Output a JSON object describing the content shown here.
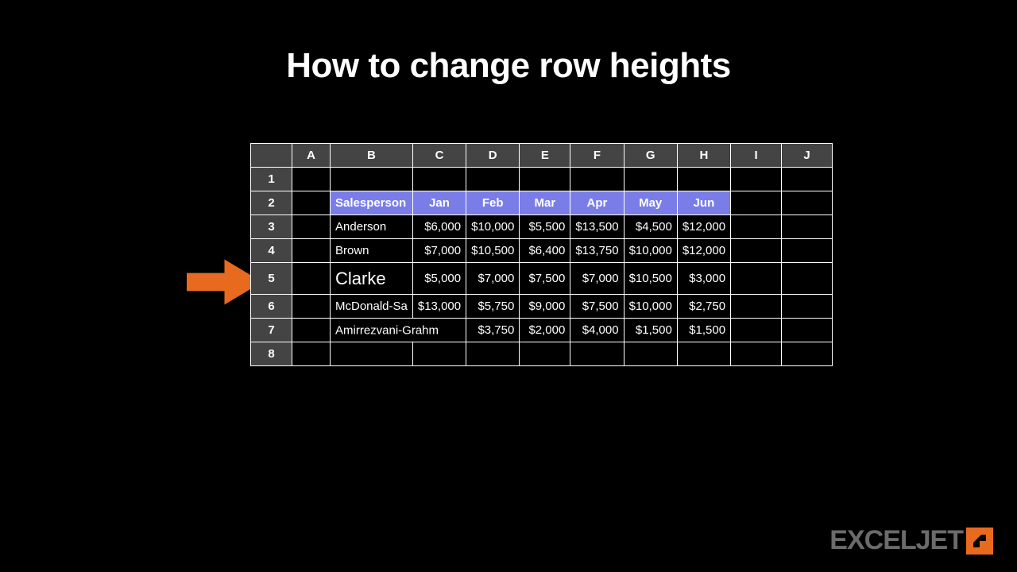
{
  "title": "How to change row heights",
  "columns": [
    "A",
    "B",
    "C",
    "D",
    "E",
    "F",
    "G",
    "H",
    "I",
    "J"
  ],
  "row_numbers": [
    "1",
    "2",
    "3",
    "4",
    "5",
    "6",
    "7",
    "8"
  ],
  "header_row": {
    "salesperson": "Salesperson",
    "months": [
      "Jan",
      "Feb",
      "Mar",
      "Apr",
      "May",
      "Jun"
    ]
  },
  "data_rows": [
    {
      "name": "Anderson",
      "vals": [
        "$6,000",
        "$10,000",
        "$5,500",
        "$13,500",
        "$4,500",
        "$12,000"
      ]
    },
    {
      "name": "Brown",
      "vals": [
        "$7,000",
        "$10,500",
        "$6,400",
        "$13,750",
        "$10,000",
        "$12,000"
      ]
    },
    {
      "name": "Clarke",
      "vals": [
        "$5,000",
        "$7,000",
        "$7,500",
        "$7,000",
        "$10,500",
        "$3,000"
      ]
    },
    {
      "name": "McDonald-Sa",
      "vals": [
        "$13,000",
        "$5,750",
        "$9,000",
        "$7,500",
        "$10,000",
        "$2,750"
      ]
    },
    {
      "name": "Amirrezvani-Grahm",
      "vals": [
        "",
        "$3,750",
        "$2,000",
        "$4,000",
        "$1,500",
        "$1,500"
      ]
    }
  ],
  "logo_text": "EXCELJET"
}
